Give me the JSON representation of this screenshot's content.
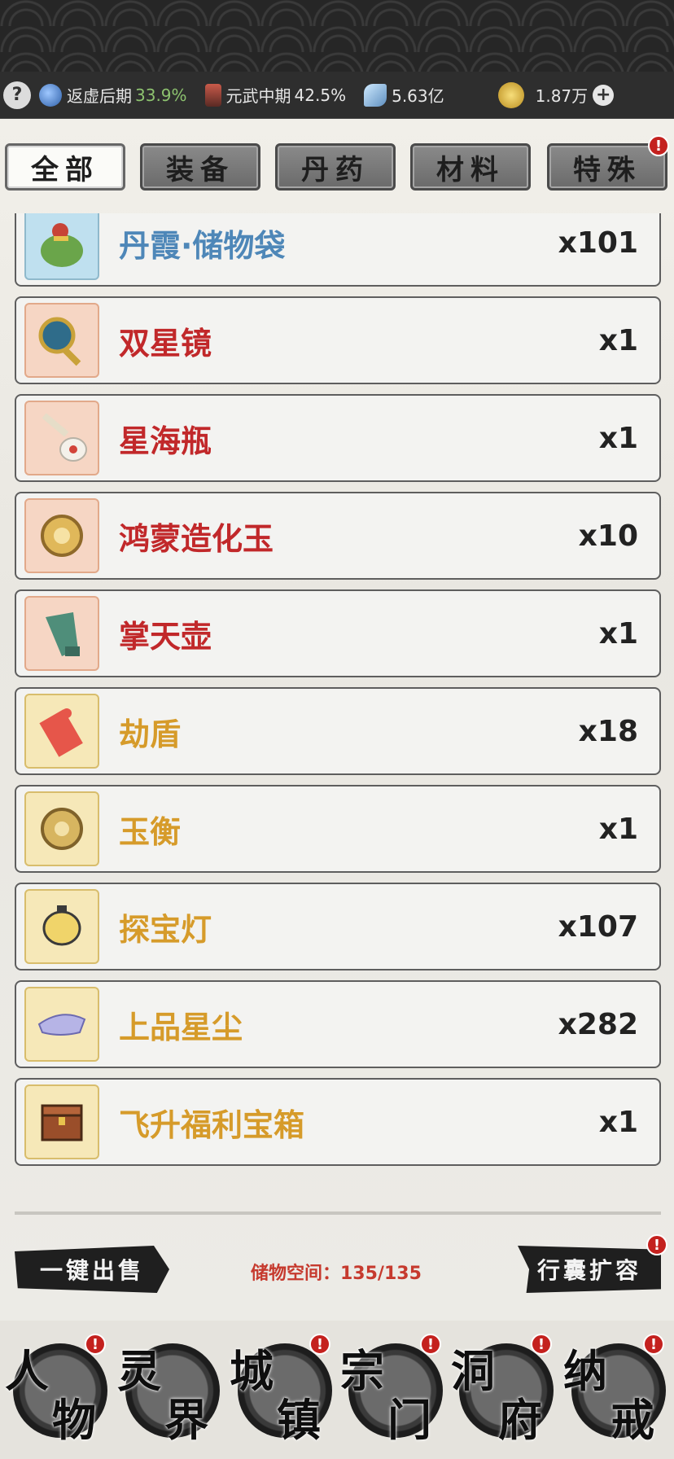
{
  "status": {
    "help": "?",
    "realm": {
      "label": "返虚后期",
      "pct": "33.9%"
    },
    "martial": {
      "label": "元武中期",
      "pct": "42.5%"
    },
    "spirit_stone": "5.63亿",
    "coins": "1.87万",
    "plus": "+"
  },
  "tabs": [
    {
      "label": "全部",
      "active": true
    },
    {
      "label": "装备"
    },
    {
      "label": "丹药"
    },
    {
      "label": "材料"
    },
    {
      "label": "特殊",
      "badge": "!"
    }
  ],
  "items": [
    {
      "name": "丹霞·储物袋",
      "qty": "x101",
      "rarity": "blue",
      "icon": "bag-icon",
      "badge": "!"
    },
    {
      "name": "双星镜",
      "qty": "x1",
      "rarity": "red",
      "icon": "mirror-icon"
    },
    {
      "name": "星海瓶",
      "qty": "x1",
      "rarity": "red",
      "icon": "bottle-icon"
    },
    {
      "name": "鸿蒙造化玉",
      "qty": "x10",
      "rarity": "red",
      "icon": "jade-icon"
    },
    {
      "name": "掌天壶",
      "qty": "x1",
      "rarity": "red",
      "icon": "pot-icon"
    },
    {
      "name": "劫盾",
      "qty": "x18",
      "rarity": "gold",
      "icon": "talisman-icon"
    },
    {
      "name": "玉衡",
      "qty": "x1",
      "rarity": "gold",
      "icon": "jade-icon"
    },
    {
      "name": "探宝灯",
      "qty": "x107",
      "rarity": "gold",
      "icon": "lantern-icon"
    },
    {
      "name": "上品星尘",
      "qty": "x282",
      "rarity": "gold",
      "icon": "stardust-icon"
    },
    {
      "name": "飞升福利宝箱",
      "qty": "x1",
      "rarity": "gold",
      "icon": "chest-icon"
    }
  ],
  "bottom": {
    "sell_all": "一键出售",
    "storage": "储物空间：135/135",
    "expand": "行囊扩容",
    "badge": "!"
  },
  "nav": [
    {
      "c1": "人",
      "c2": "物",
      "badge": "!"
    },
    {
      "c1": "灵",
      "c2": "界"
    },
    {
      "c1": "城",
      "c2": "镇",
      "badge": "!"
    },
    {
      "c1": "宗",
      "c2": "门",
      "badge": "!"
    },
    {
      "c1": "洞",
      "c2": "府",
      "badge": "!"
    },
    {
      "c1": "纳",
      "c2": "戒",
      "badge": "!"
    }
  ]
}
